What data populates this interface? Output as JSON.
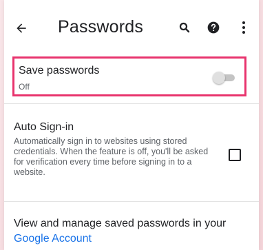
{
  "toolbar": {
    "title": "Passwords",
    "back_icon": "arrow-back-icon",
    "search_icon": "search-icon",
    "help_icon": "help-icon",
    "more_icon": "more-vert-icon"
  },
  "save_passwords": {
    "label": "Save passwords",
    "status": "Off",
    "enabled": false
  },
  "auto_signin": {
    "label": "Auto Sign-in",
    "description": "Automatically sign in to websites using stored credentials. When the feature is off, you'll be asked for verification every time before signing in to a website.",
    "checked": false
  },
  "manage": {
    "text_prefix": "View and manage saved passwords in your ",
    "link_text": "Google Account"
  },
  "colors": {
    "highlight": "#e8336d",
    "link": "#1a73e8",
    "background": "#f7dfe3"
  }
}
